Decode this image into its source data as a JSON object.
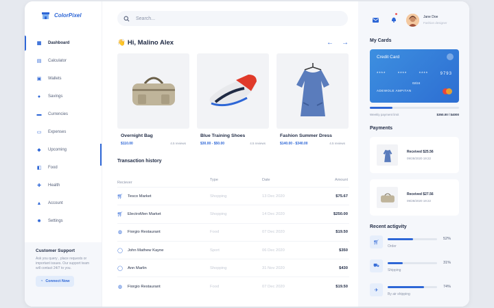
{
  "app": {
    "name": "ColorPixel"
  },
  "sidebar": {
    "items": [
      {
        "label": "Dashboard",
        "icon": "dashboard-icon",
        "active": true
      },
      {
        "label": "Calculator",
        "icon": "calculator-icon"
      },
      {
        "label": "Wallets",
        "icon": "wallet-icon"
      },
      {
        "label": "Savings",
        "icon": "savings-icon"
      },
      {
        "label": "Currencies",
        "icon": "currency-icon"
      },
      {
        "label": "Expenses",
        "icon": "expenses-icon"
      },
      {
        "label": "Upcoming",
        "icon": "upcoming-icon"
      },
      {
        "label": "Food",
        "icon": "food-icon"
      },
      {
        "label": "Health",
        "icon": "health-icon"
      },
      {
        "label": "Account",
        "icon": "account-icon"
      },
      {
        "label": "Settings",
        "icon": "settings-icon"
      }
    ],
    "support": {
      "title": "Customer Support",
      "text": "Ask you query , place requests or important issues. Our support team will contact 24/7 to you.",
      "button": "Connect Now"
    }
  },
  "search": {
    "placeholder": "Search..."
  },
  "greeting": {
    "emoji": "👋",
    "text": "Hi, Malino Alex"
  },
  "products": [
    {
      "name": "Overnight Bag",
      "price": "$110.00",
      "reviews": "4.5 reviews"
    },
    {
      "name": "Blue Training Shoes",
      "price": "$30.00 - $50.00",
      "reviews": "4.5 reviews"
    },
    {
      "name": "Fashion Summer Dress",
      "price": "$140.00 - $340.00",
      "reviews": "4.5 reviews"
    }
  ],
  "transactions": {
    "title": "Transaction history",
    "columns": [
      "Reciever",
      "Type",
      "Date",
      "Amount"
    ],
    "rows": [
      {
        "receiver": "Tesco Market",
        "type": "Shopping",
        "date": "13 Dec 2020",
        "amount": "$75.67",
        "icon": "cart-icon"
      },
      {
        "receiver": "ElectroMen Market",
        "type": "Shopping",
        "date": "14 Dec 2020",
        "amount": "$250.00",
        "icon": "cart-icon"
      },
      {
        "receiver": "Fiorgio Restaurant",
        "type": "Food",
        "date": "07 Dec 2020",
        "amount": "$19.50",
        "icon": "food-icon"
      },
      {
        "receiver": "John Mathew Kayne",
        "type": "Sport",
        "date": "06 Dec 2020",
        "amount": "$350",
        "icon": "user-icon"
      },
      {
        "receiver": "Ann Marlin",
        "type": "Shopping",
        "date": "31 Nov 2020",
        "amount": "$430",
        "icon": "user-icon"
      },
      {
        "receiver": "Fiorgio Restaurant",
        "type": "Food",
        "date": "07 Dec 2020",
        "amount": "$19.50",
        "icon": "food-icon"
      }
    ]
  },
  "user": {
    "name": "Jane Doe",
    "role": "Fashion designer"
  },
  "cards": {
    "title": "My Cards",
    "card": {
      "label": "Credit Card",
      "number": [
        "****",
        "****",
        "****",
        "9793"
      ],
      "expiry": "02/24",
      "holder": "ADEWOLE AMPITAN"
    },
    "limit_label": "Weekly payment limit",
    "limit_value": "$350.00 / $4000",
    "limit_fraction": 0.25
  },
  "payments": {
    "title": "Payments",
    "items": [
      {
        "text": "Received $25.56",
        "date": "09/28/2020 19:22"
      },
      {
        "text": "Received $27.56",
        "date": "09/28/2020 19:22"
      }
    ]
  },
  "activity": {
    "title": "Recent actigvity",
    "items": [
      {
        "label": "Order",
        "pct": "52%",
        "value": 0.52,
        "icon": "cart-icon"
      },
      {
        "label": "Shipping",
        "pct": "31%",
        "value": 0.31,
        "icon": "truck-icon"
      },
      {
        "label": "By air shipping",
        "pct": "74%",
        "value": 0.74,
        "icon": "plane-icon"
      }
    ]
  },
  "colors": {
    "accent": "#2d66d6",
    "card": "#3d8fe0"
  }
}
